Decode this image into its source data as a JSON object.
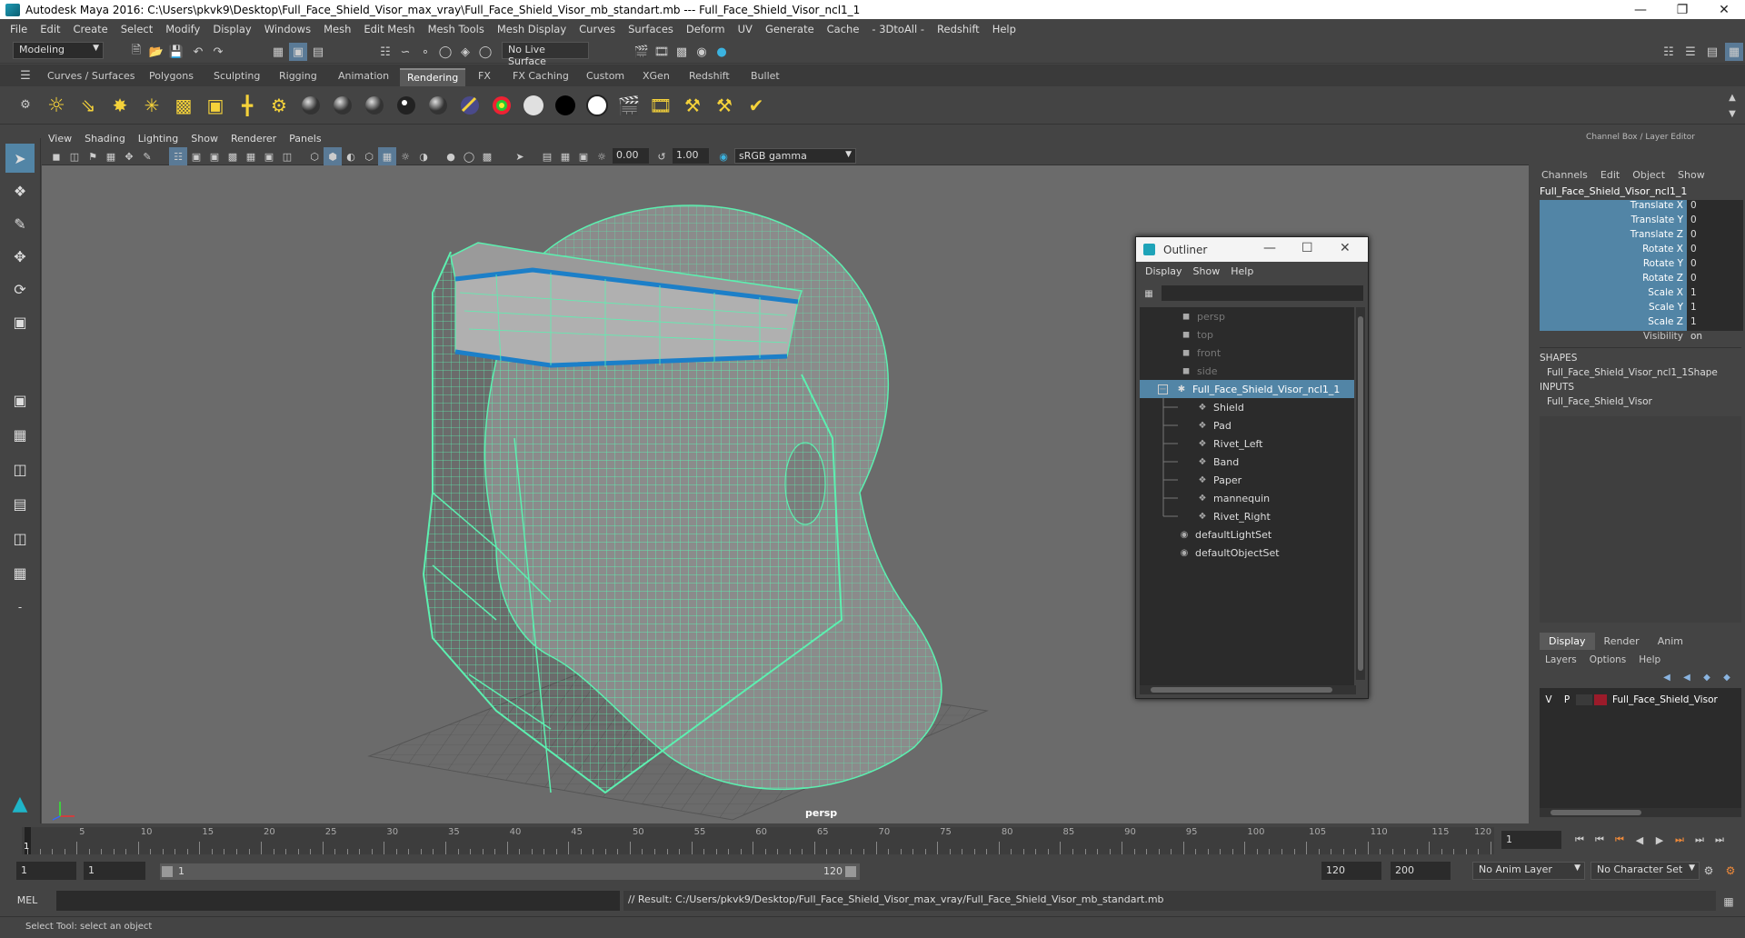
{
  "app": {
    "title": "Autodesk Maya 2016: C:\\Users\\pkvk9\\Desktop\\Full_Face_Shield_Visor_max_vray\\Full_Face_Shield_Visor_mb_standart.mb   ---   Full_Face_Shield_Visor_ncl1_1"
  },
  "menu": [
    "File",
    "Edit",
    "Create",
    "Select",
    "Modify",
    "Display",
    "Windows",
    "Mesh",
    "Edit Mesh",
    "Mesh Tools",
    "Mesh Display",
    "Curves",
    "Surfaces",
    "Deform",
    "UV",
    "Generate",
    "Cache",
    "- 3DtoAll -",
    "Redshift",
    "Help"
  ],
  "status": {
    "mode": "Modeling",
    "live_surface": "No Live Surface"
  },
  "shelf_tabs": [
    "Curves / Surfaces",
    "Polygons",
    "Sculpting",
    "Rigging",
    "Animation",
    "Rendering",
    "FX",
    "FX Caching",
    "Custom",
    "XGen",
    "Redshift",
    "Bullet"
  ],
  "active_shelf": "Rendering",
  "viewport": {
    "menu": [
      "View",
      "Shading",
      "Lighting",
      "Show",
      "Renderer",
      "Panels"
    ],
    "exposure": "0.00",
    "gamma": "1.00",
    "color_space": "sRGB gamma",
    "camera_label": "persp"
  },
  "outliner": {
    "title": "Outliner",
    "menu": [
      "Display",
      "Show",
      "Help"
    ],
    "items": [
      {
        "label": "persp",
        "icon": "camera-icon",
        "level": 0,
        "dim": true
      },
      {
        "label": "top",
        "icon": "camera-icon",
        "level": 0,
        "dim": true
      },
      {
        "label": "front",
        "icon": "camera-icon",
        "level": 0,
        "dim": true
      },
      {
        "label": "side",
        "icon": "camera-icon",
        "level": 0,
        "dim": true
      },
      {
        "label": "Full_Face_Shield_Visor_ncl1_1",
        "icon": "group-icon",
        "level": 0,
        "selected": true
      },
      {
        "label": "Shield",
        "icon": "mesh-icon",
        "level": 1
      },
      {
        "label": "Pad",
        "icon": "mesh-icon",
        "level": 1
      },
      {
        "label": "Rivet_Left",
        "icon": "mesh-icon",
        "level": 1
      },
      {
        "label": "Band",
        "icon": "mesh-icon",
        "level": 1
      },
      {
        "label": "Paper",
        "icon": "mesh-icon",
        "level": 1
      },
      {
        "label": "mannequin",
        "icon": "mesh-icon",
        "level": 1
      },
      {
        "label": "Rivet_Right",
        "icon": "mesh-icon",
        "level": 1
      },
      {
        "label": "defaultLightSet",
        "icon": "set-icon",
        "level": 0
      },
      {
        "label": "defaultObjectSet",
        "icon": "set-icon",
        "level": 0
      }
    ]
  },
  "channel_box": {
    "header": "Channel Box / Layer Editor",
    "menu": [
      "Channels",
      "Edit",
      "Object",
      "Show"
    ],
    "object_name": "Full_Face_Shield_Visor_ncl1_1",
    "channels": [
      {
        "label": "Translate X",
        "value": "0"
      },
      {
        "label": "Translate Y",
        "value": "0"
      },
      {
        "label": "Translate Z",
        "value": "0"
      },
      {
        "label": "Rotate X",
        "value": "0"
      },
      {
        "label": "Rotate Y",
        "value": "0"
      },
      {
        "label": "Rotate Z",
        "value": "0"
      },
      {
        "label": "Scale X",
        "value": "1"
      },
      {
        "label": "Scale Y",
        "value": "1"
      },
      {
        "label": "Scale Z",
        "value": "1"
      }
    ],
    "visibility": {
      "label": "Visibility",
      "value": "on"
    },
    "shapes_header": "SHAPES",
    "shape_name": "Full_Face_Shield_Visor_ncl1_1Shape",
    "inputs_header": "INPUTS",
    "input_name": "Full_Face_Shield_Visor"
  },
  "layer_editor": {
    "tabs": [
      "Display",
      "Render",
      "Anim"
    ],
    "menu": [
      "Layers",
      "Options",
      "Help"
    ],
    "layer": {
      "v": "V",
      "p": "P",
      "name": "Full_Face_Shield_Visor",
      "color": "#9b1b2a"
    }
  },
  "timeline": {
    "ticks": [
      "5",
      "10",
      "15",
      "20",
      "25",
      "30",
      "35",
      "40",
      "45",
      "50",
      "55",
      "60",
      "65",
      "70",
      "75",
      "80",
      "85",
      "90",
      "95",
      "100",
      "105",
      "110",
      "115",
      "120"
    ],
    "current_frame_marker": "1",
    "current_frame": "1"
  },
  "range": {
    "start": "1",
    "playback_start": "1",
    "range_start": "1",
    "range_end_label": "120",
    "playback_end": "120",
    "end": "200",
    "anim_layer": "No Anim Layer",
    "char_set": "No Character Set"
  },
  "command": {
    "label": "MEL",
    "result": "// Result: C:/Users/pkvk9/Desktop/Full_Face_Shield_Visor_max_vray/Full_Face_Shield_Visor_mb_standart.mb"
  },
  "help_line": "Select Tool: select an object",
  "colors": {
    "wire": "#5cf0b0",
    "band": "#1c7fc8",
    "selection": "#5285a6"
  }
}
